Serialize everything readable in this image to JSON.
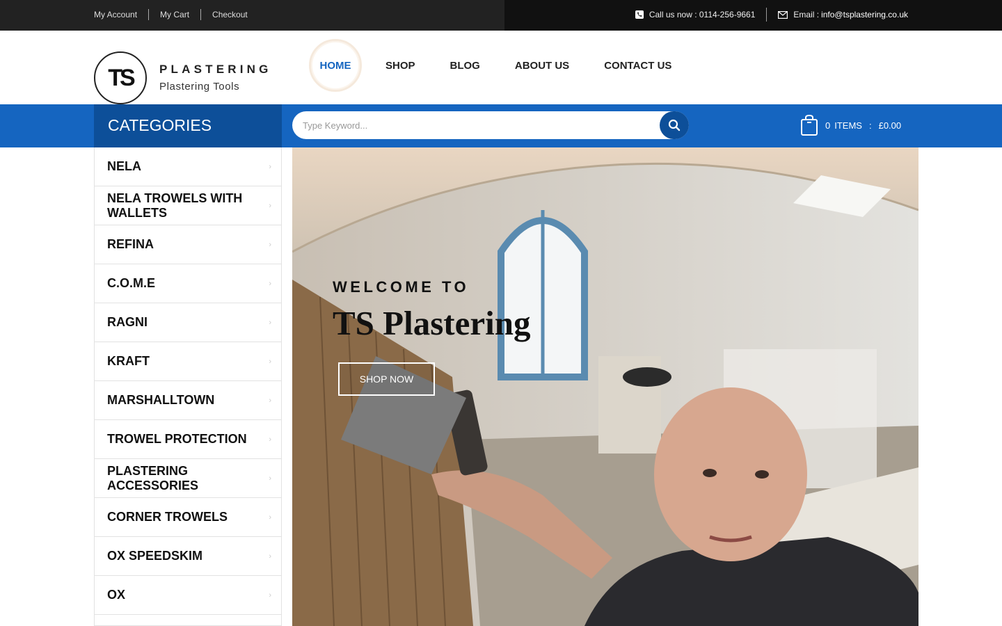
{
  "topbar": {
    "links": [
      "My Account",
      "My Cart",
      "Checkout"
    ],
    "call_label": "Call us now : 0114-256-9661",
    "email_prefix": "Email : ",
    "email": "info@tsplastering.co.uk"
  },
  "logo": {
    "mark": "TS",
    "word": "PLASTERING",
    "sub": "Plastering Tools"
  },
  "nav": [
    "HOME",
    "SHOP",
    "BLOG",
    "ABOUT US",
    "CONTACT US"
  ],
  "categories_title": "CATEGORIES",
  "search": {
    "placeholder": "Type Keyword..."
  },
  "cart": {
    "count": "0",
    "items_label": "ITEMS",
    "sep": ":",
    "total": "£0.00"
  },
  "categories": [
    "NELA",
    "NELA TROWELS WITH WALLETS",
    "REFINA",
    "C.O.M.E",
    "RAGNI",
    "KRAFT",
    "MARSHALLTOWN",
    "TROWEL PROTECTION",
    "PLASTERING ACCESSORIES",
    "CORNER TROWELS",
    "OX SPEEDSKIM",
    "OX"
  ],
  "hero": {
    "welcome": "WELCOME TO",
    "title": "TS Plastering",
    "button": "SHOP NOW"
  },
  "colors": {
    "brand_blue": "#1565c0",
    "dark_blue": "#0d4f99",
    "topbar": "#222222"
  }
}
